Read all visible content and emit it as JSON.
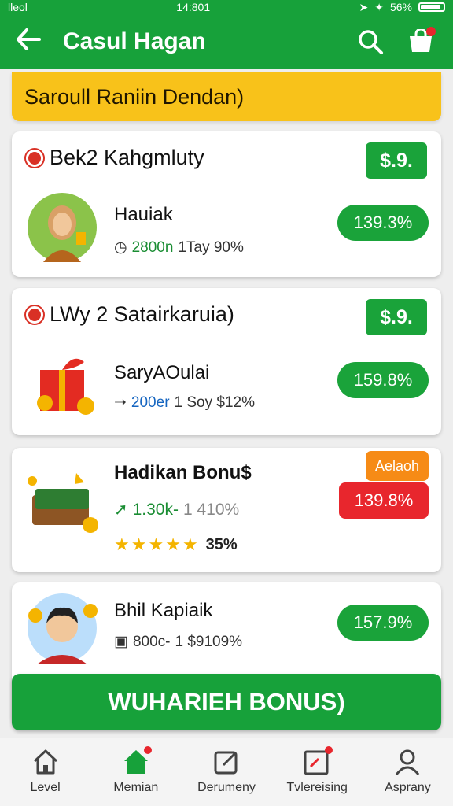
{
  "status_bar": {
    "left": "lleol",
    "time": "14:801",
    "battery": "56%"
  },
  "app_bar": {
    "title": "Casul Hagan",
    "back_icon": "arrow-left-icon",
    "search_icon": "search-icon",
    "cart_icon": "cart-icon"
  },
  "banner": {
    "text": "Saroull Raniin Dendan)"
  },
  "cards": [
    {
      "header": "Bek2 Kahgmluty",
      "price": "$.9.",
      "name": "Hauiak",
      "meta_a": "2800n",
      "meta_b": "1Tay 90%",
      "pct": "139.3%"
    },
    {
      "header": "LWy 2 Satairkaruia)",
      "price": "$.9.",
      "name": "SaryAOulai",
      "meta_a": "200er",
      "meta_b": "1 Soy $12%",
      "pct": "159.8%"
    },
    {
      "name": "Hadikan Bonu$",
      "tag": "Aelaoh",
      "meta_a": "1.30k-",
      "meta_b": "1 410%",
      "rating": "35%",
      "pct": "139.8%"
    },
    {
      "name": "Bhil Kapiaik",
      "meta_a": "800c-",
      "meta_b": "1 $9109%",
      "pct": "157.9%"
    }
  ],
  "cta": {
    "label": "WUHARIEH BONUS)"
  },
  "bottom_nav": [
    {
      "label": "Level",
      "icon": "home-icon"
    },
    {
      "label": "Memian",
      "icon": "home-filled-icon"
    },
    {
      "label": "Derumeny",
      "icon": "edit-icon"
    },
    {
      "label": "Tvlereising",
      "icon": "image-edit-icon"
    },
    {
      "label": "Asprany",
      "icon": "user-icon"
    }
  ],
  "colors": {
    "primary": "#17a13a",
    "banner": "#f8c21a",
    "alert": "#e8262d",
    "tag": "#f68b16"
  }
}
